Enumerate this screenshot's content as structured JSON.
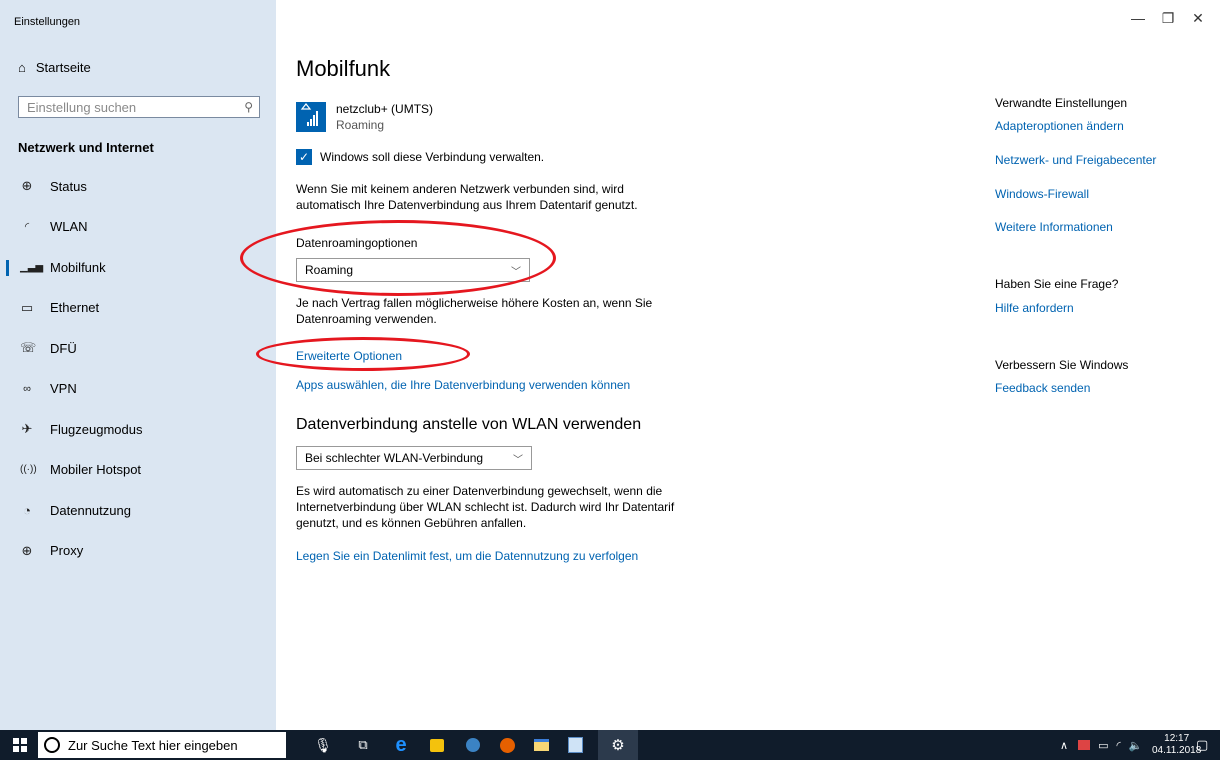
{
  "window": {
    "title": "Einstellungen",
    "controls": {
      "minimize": "—",
      "maximize": "❐",
      "close": "✕"
    }
  },
  "sidebar": {
    "home_label": "Startseite",
    "search_placeholder": "Einstellung suchen",
    "section_title": "Netzwerk und Internet",
    "items": [
      {
        "label": "Status",
        "icon": "globe-icon"
      },
      {
        "label": "WLAN",
        "icon": "wifi-icon"
      },
      {
        "label": "Mobilfunk",
        "icon": "cellular-icon",
        "active": true
      },
      {
        "label": "Ethernet",
        "icon": "ethernet-icon"
      },
      {
        "label": "DFÜ",
        "icon": "dialup-icon"
      },
      {
        "label": "VPN",
        "icon": "vpn-icon"
      },
      {
        "label": "Flugzeugmodus",
        "icon": "airplane-icon"
      },
      {
        "label": "Mobiler Hotspot",
        "icon": "hotspot-icon"
      },
      {
        "label": "Datennutzung",
        "icon": "data-usage-icon"
      },
      {
        "label": "Proxy",
        "icon": "globe-icon"
      }
    ]
  },
  "main": {
    "title": "Mobilfunk",
    "connection": {
      "name": "netzclub+ (UMTS)",
      "status": "Roaming"
    },
    "manage_checkbox_label": "Windows soll diese Verbindung verwalten.",
    "auto_text": "Wenn Sie mit keinem anderen Netzwerk verbunden sind, wird automatisch Ihre Datenverbindung aus Ihrem Datentarif genutzt.",
    "roaming_label": "Datenroamingoptionen",
    "roaming_value": "Roaming",
    "roaming_note": "Je nach Vertrag fallen möglicherweise höhere Kosten an, wenn Sie Datenroaming verwenden.",
    "advanced_link": "Erweiterte Optionen",
    "apps_link": "Apps auswählen, die Ihre Datenverbindung verwenden können",
    "wlan_heading": "Datenverbindung anstelle von WLAN verwenden",
    "wlan_value": "Bei schlechter WLAN-Verbindung",
    "wlan_note": "Es wird automatisch zu einer Datenverbindung gewechselt, wenn die Internetverbindung über WLAN schlecht ist. Dadurch wird Ihr Datentarif genutzt, und es können Gebühren anfallen.",
    "limit_link": "Legen Sie ein Datenlimit fest, um die Datennutzung zu verfolgen"
  },
  "related": {
    "heading": "Verwandte Einstellungen",
    "links": [
      "Adapteroptionen ändern",
      "Netzwerk- und Freigabecenter",
      "Windows-Firewall",
      "Weitere Informationen"
    ],
    "question_heading": "Haben Sie eine Frage?",
    "question_link": "Hilfe anfordern",
    "improve_heading": "Verbessern Sie Windows",
    "improve_link": "Feedback senden"
  },
  "taskbar": {
    "search_placeholder": "Zur Suche Text hier eingeben",
    "time": "12:17",
    "date": "04.11.2018"
  },
  "colors": {
    "accent": "#0063b1",
    "sidebar_bg": "#dbe6f2",
    "highlight_red": "#e5171f",
    "taskbar_bg": "#101c2b"
  }
}
